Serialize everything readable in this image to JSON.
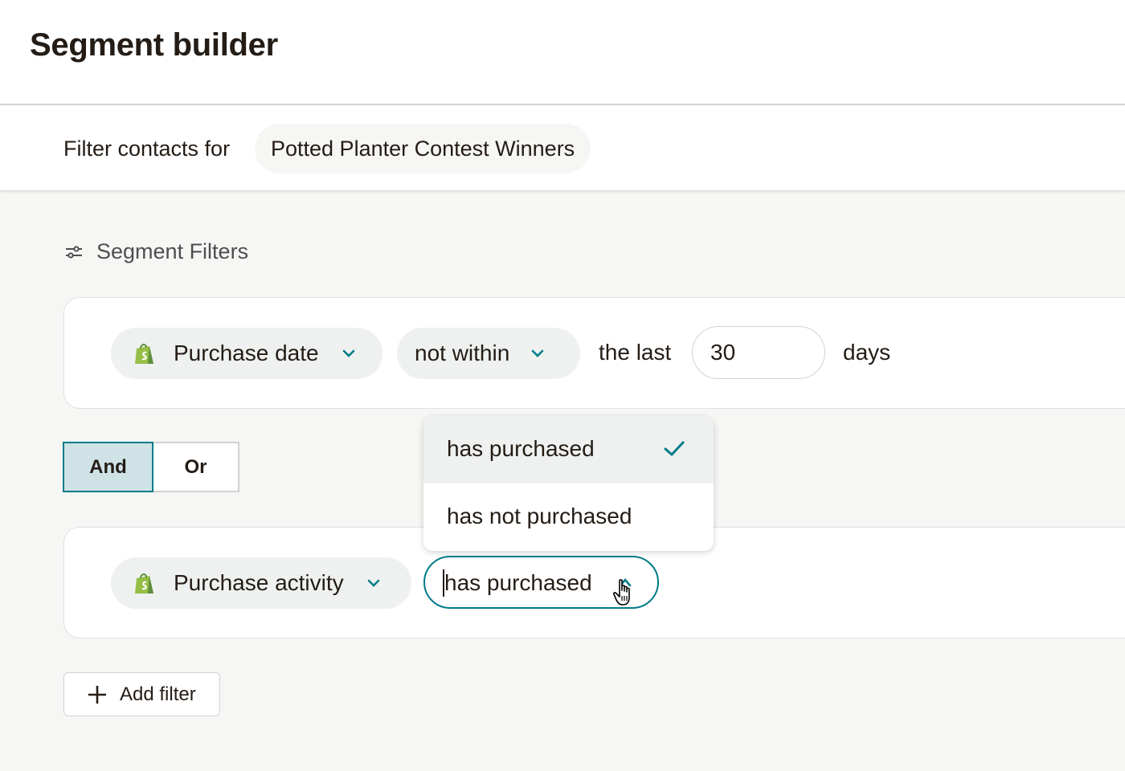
{
  "header": {
    "title": "Segment builder"
  },
  "audience": {
    "label": "Filter contacts for",
    "name": "Potted Planter Contest Winners"
  },
  "filters_section": {
    "heading": "Segment Filters",
    "icon": "sliders-icon"
  },
  "filter_1": {
    "field": "Purchase date",
    "field_icon": "shopify-icon",
    "operator": "not within",
    "text_before_value": "the last",
    "value": "30",
    "unit": "days"
  },
  "logic_toggle": {
    "and_label": "And",
    "or_label": "Or",
    "selected": "And"
  },
  "filter_2": {
    "field": "Purchase activity",
    "field_icon": "shopify-icon",
    "operator": "has purchased"
  },
  "operator_dropdown": {
    "options": [
      {
        "label": "has purchased",
        "selected": true
      },
      {
        "label": "has not purchased",
        "selected": false
      }
    ]
  },
  "add_filter": {
    "label": "Add filter"
  },
  "colors": {
    "accent": "#007c89",
    "toggle_selected_bg": "#cfe3e7",
    "shopify_green": "#95bf47",
    "chip_bg": "#eef1ef",
    "page_bg": "#f6f6f4"
  }
}
